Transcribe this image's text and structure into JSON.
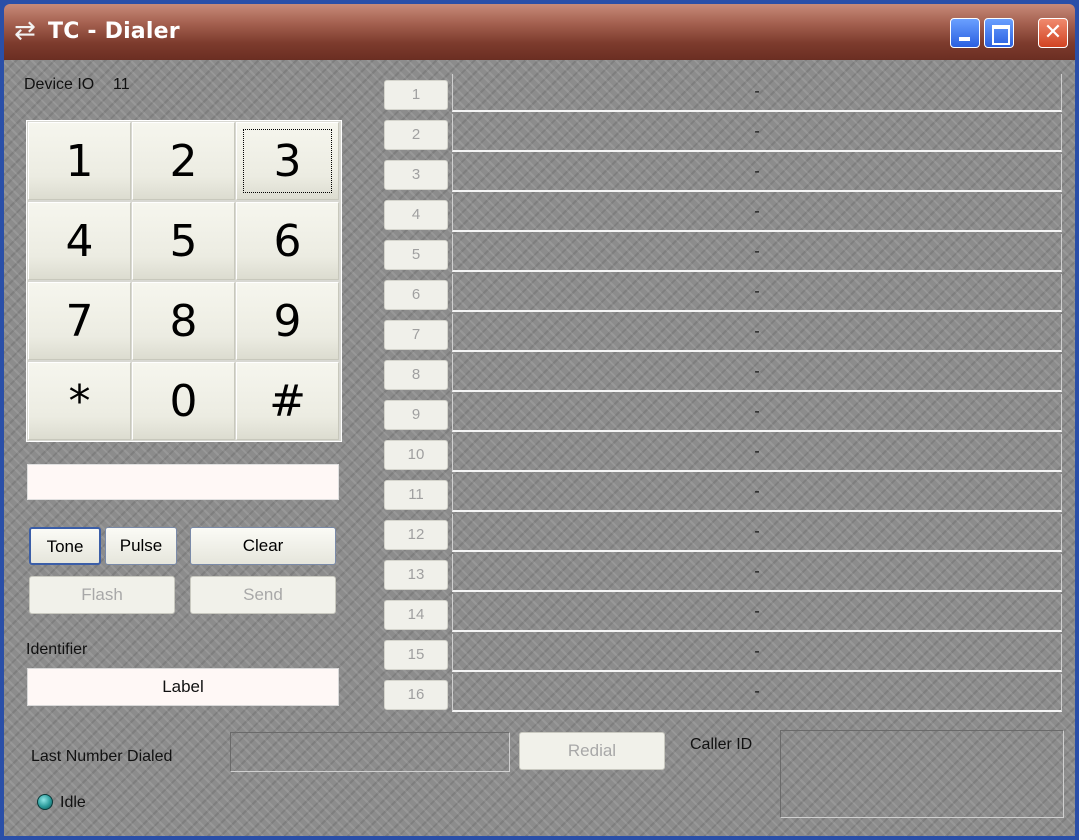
{
  "window": {
    "icon": "swap-arrows-icon",
    "title": "TC - Dialer"
  },
  "device": {
    "label": "Device IO",
    "value": "11"
  },
  "keypad": {
    "keys": [
      "1",
      "2",
      "3",
      "4",
      "5",
      "6",
      "7",
      "8",
      "9",
      "*",
      "0",
      "#"
    ]
  },
  "dial_entry": {
    "value": ""
  },
  "buttons": {
    "tone": "Tone",
    "pulse": "Pulse",
    "clear": "Clear",
    "flash": "Flash",
    "send": "Send",
    "redial": "Redial"
  },
  "identifier": {
    "label": "Identifier",
    "value": "Label"
  },
  "rows": [
    {
      "num": "1",
      "value": "-"
    },
    {
      "num": "2",
      "value": "-"
    },
    {
      "num": "3",
      "value": "-"
    },
    {
      "num": "4",
      "value": "-"
    },
    {
      "num": "5",
      "value": "-"
    },
    {
      "num": "6",
      "value": "-"
    },
    {
      "num": "7",
      "value": "-"
    },
    {
      "num": "8",
      "value": "-"
    },
    {
      "num": "9",
      "value": "-"
    },
    {
      "num": "10",
      "value": "-"
    },
    {
      "num": "11",
      "value": "-"
    },
    {
      "num": "12",
      "value": "-"
    },
    {
      "num": "13",
      "value": "-"
    },
    {
      "num": "14",
      "value": "-"
    },
    {
      "num": "15",
      "value": "-"
    },
    {
      "num": "16",
      "value": "-"
    }
  ],
  "last_number": {
    "label": "Last Number Dialed",
    "value": ""
  },
  "caller_id": {
    "label": "Caller ID",
    "value": ""
  },
  "status": {
    "text": "Idle",
    "led_color": "#2a9a9a"
  },
  "colors": {
    "title_bar": "#7d3b2d",
    "window_frame": "#2a4fa8",
    "body": "#8c8c8c"
  }
}
